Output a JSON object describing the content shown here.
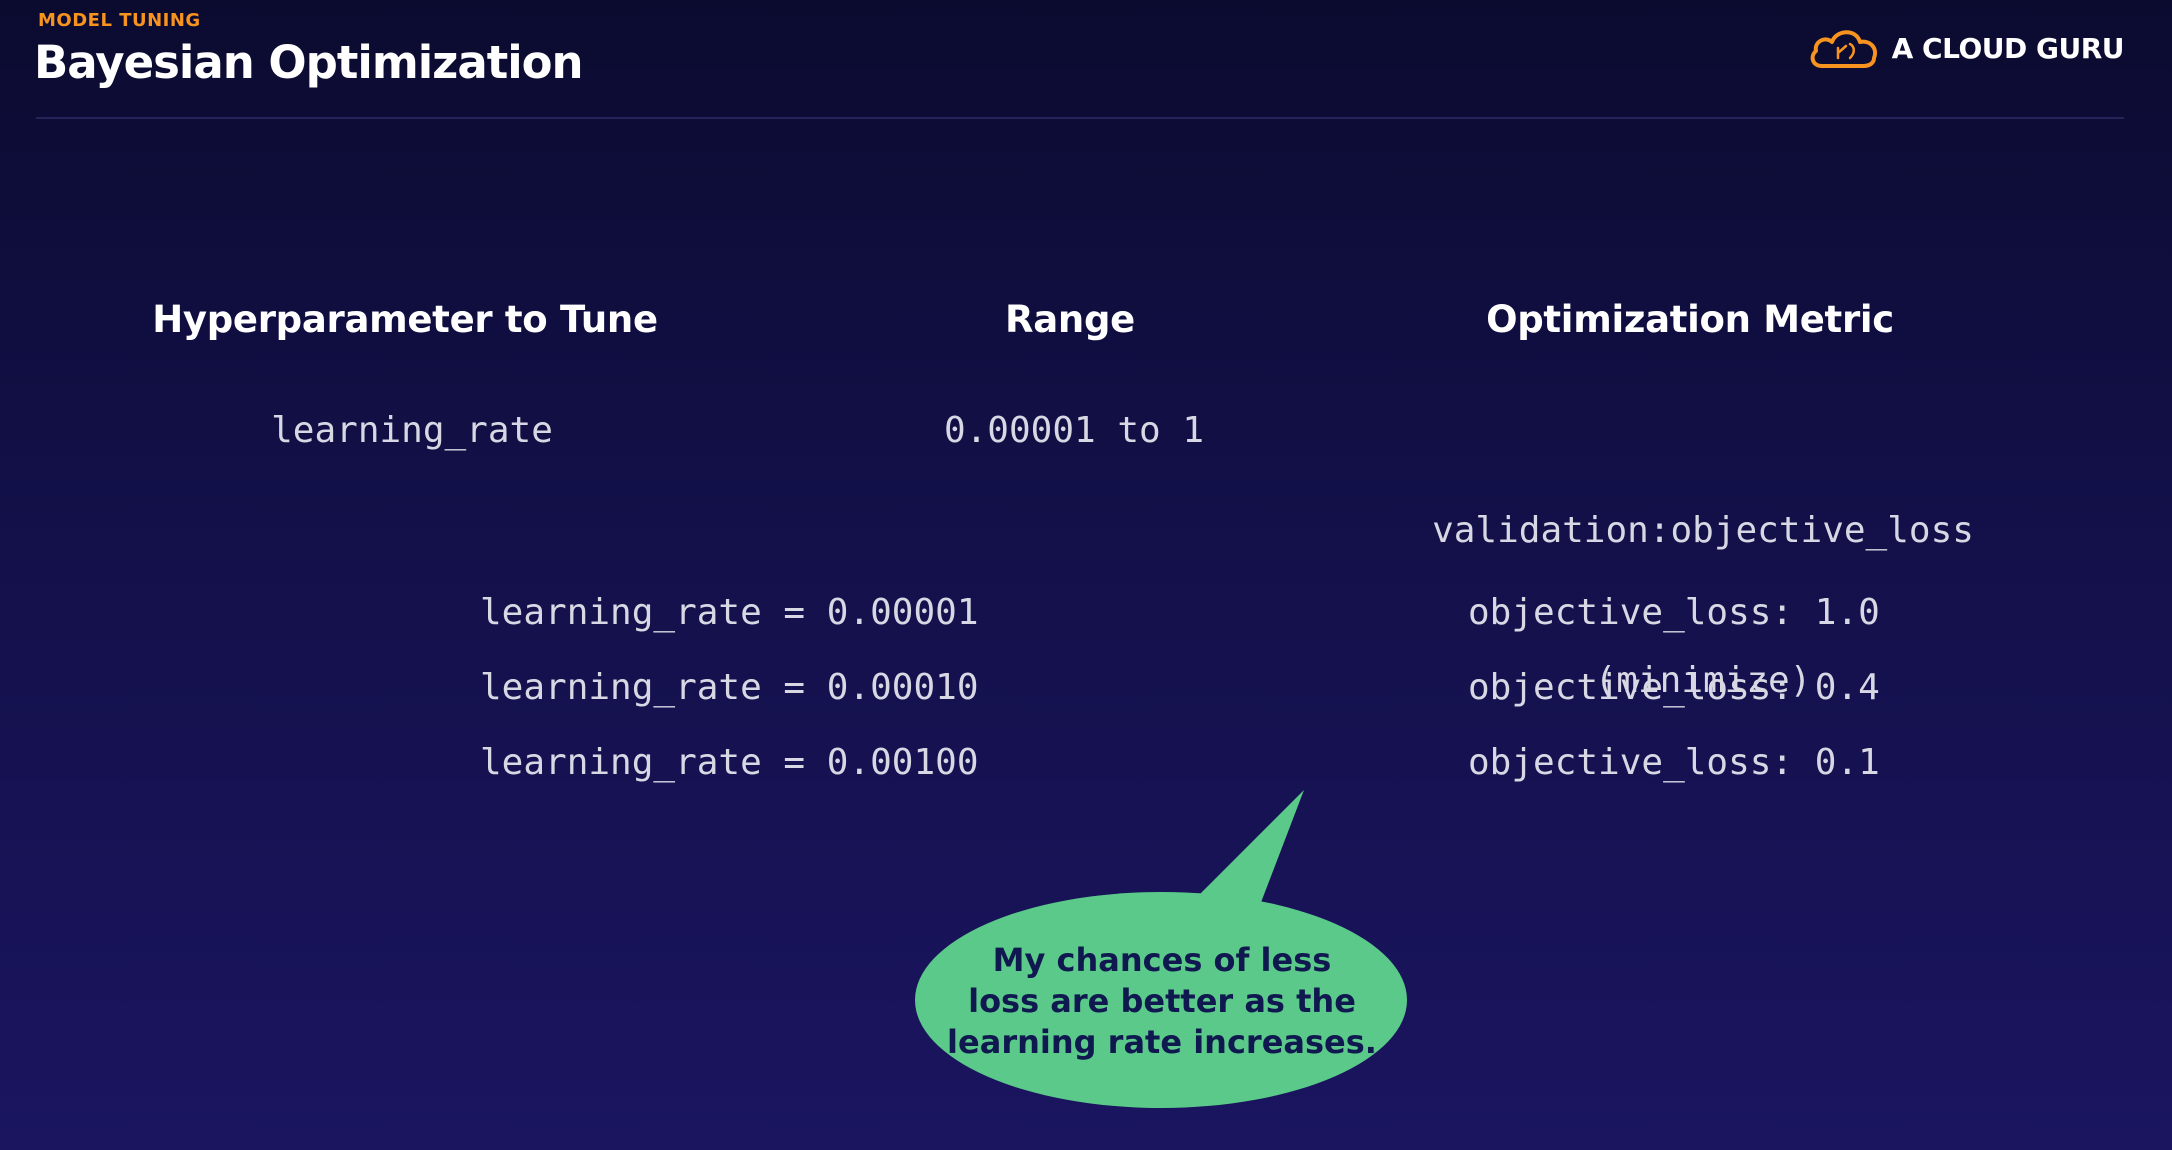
{
  "header": {
    "kicker": "MODEL TUNING",
    "title": "Bayesian Optimization",
    "brand_name": "A CLOUD GURU",
    "brand_icon": "cloud-logo-icon"
  },
  "table": {
    "headers": [
      "Hyperparameter to Tune",
      "Range",
      "Optimization Metric"
    ],
    "row": {
      "hyperparameter": "learning_rate",
      "range": "0.00001 to 1",
      "metric_line1": "validation:objective_loss",
      "metric_line2": "(minimize)"
    }
  },
  "trials": [
    {
      "setting": "learning_rate = 0.00001",
      "result": "objective_loss: 1.0"
    },
    {
      "setting": "learning_rate = 0.00010",
      "result": "objective_loss: 0.4"
    },
    {
      "setting": "learning_rate = 0.00100",
      "result": "objective_loss: 0.1"
    }
  ],
  "callout": {
    "line1": "My chances of less",
    "line2": "loss are better as the",
    "line3": "learning rate increases."
  },
  "colors": {
    "accent": "#f7931e",
    "bubble": "#5bc98a",
    "background": "#131049"
  }
}
